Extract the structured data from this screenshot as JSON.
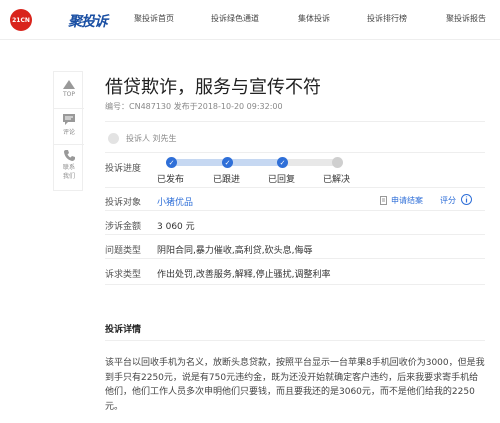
{
  "header": {
    "logo_text": "21CN",
    "brand": "聚投诉",
    "nav": [
      "聚投诉首页",
      "投诉绿色通道",
      "集体投诉",
      "投诉排行榜",
      "聚投诉报告"
    ]
  },
  "sidebar": {
    "items": [
      {
        "label": "TOP",
        "icon": "arrow-up-icon"
      },
      {
        "label": "评论",
        "icon": "comment-icon"
      },
      {
        "label": "联系\n我们",
        "icon": "phone-icon"
      }
    ]
  },
  "complaint": {
    "title": "借贷欺诈，服务与宣传不符",
    "meta": "编号：CN487130   发布于2018-10-20 09:32:00",
    "complainant": "投诉人 刘先生",
    "progress": {
      "label": "投诉进度",
      "steps": [
        "已发布",
        "已跟进",
        "已回复",
        "已解决"
      ],
      "completed": 3,
      "fill_fraction": 0.67
    },
    "target_label": "投诉对象",
    "target_value": "小猪优品",
    "apply_close": "申请结案",
    "rate": "评分",
    "amount_label": "涉诉金额",
    "amount_value": "3 060 元",
    "problem_label": "问题类型",
    "problem_value": "阴阳合同,暴力催收,高利贷,砍头息,侮辱",
    "demand_label": "诉求类型",
    "demand_value": "作出处罚,改善服务,解释,停止骚扰,调整利率"
  },
  "details": {
    "title": "投诉详情",
    "text": "该平台以回收手机为名义，放断头息贷款，按照平台显示一台苹果8手机回收价为3000，但是我到手只有2250元，说是有750元违约金，既为还没开始就确定客户违约，后来我要求寄手机给他们，他们工作人员多次申明他们只要钱，而且要我还的是3060元，而不是他们给我的2250元。"
  },
  "colors": {
    "accent": "#2f6fd8",
    "logo": "#d9241c",
    "brand": "#1a4fa3"
  }
}
